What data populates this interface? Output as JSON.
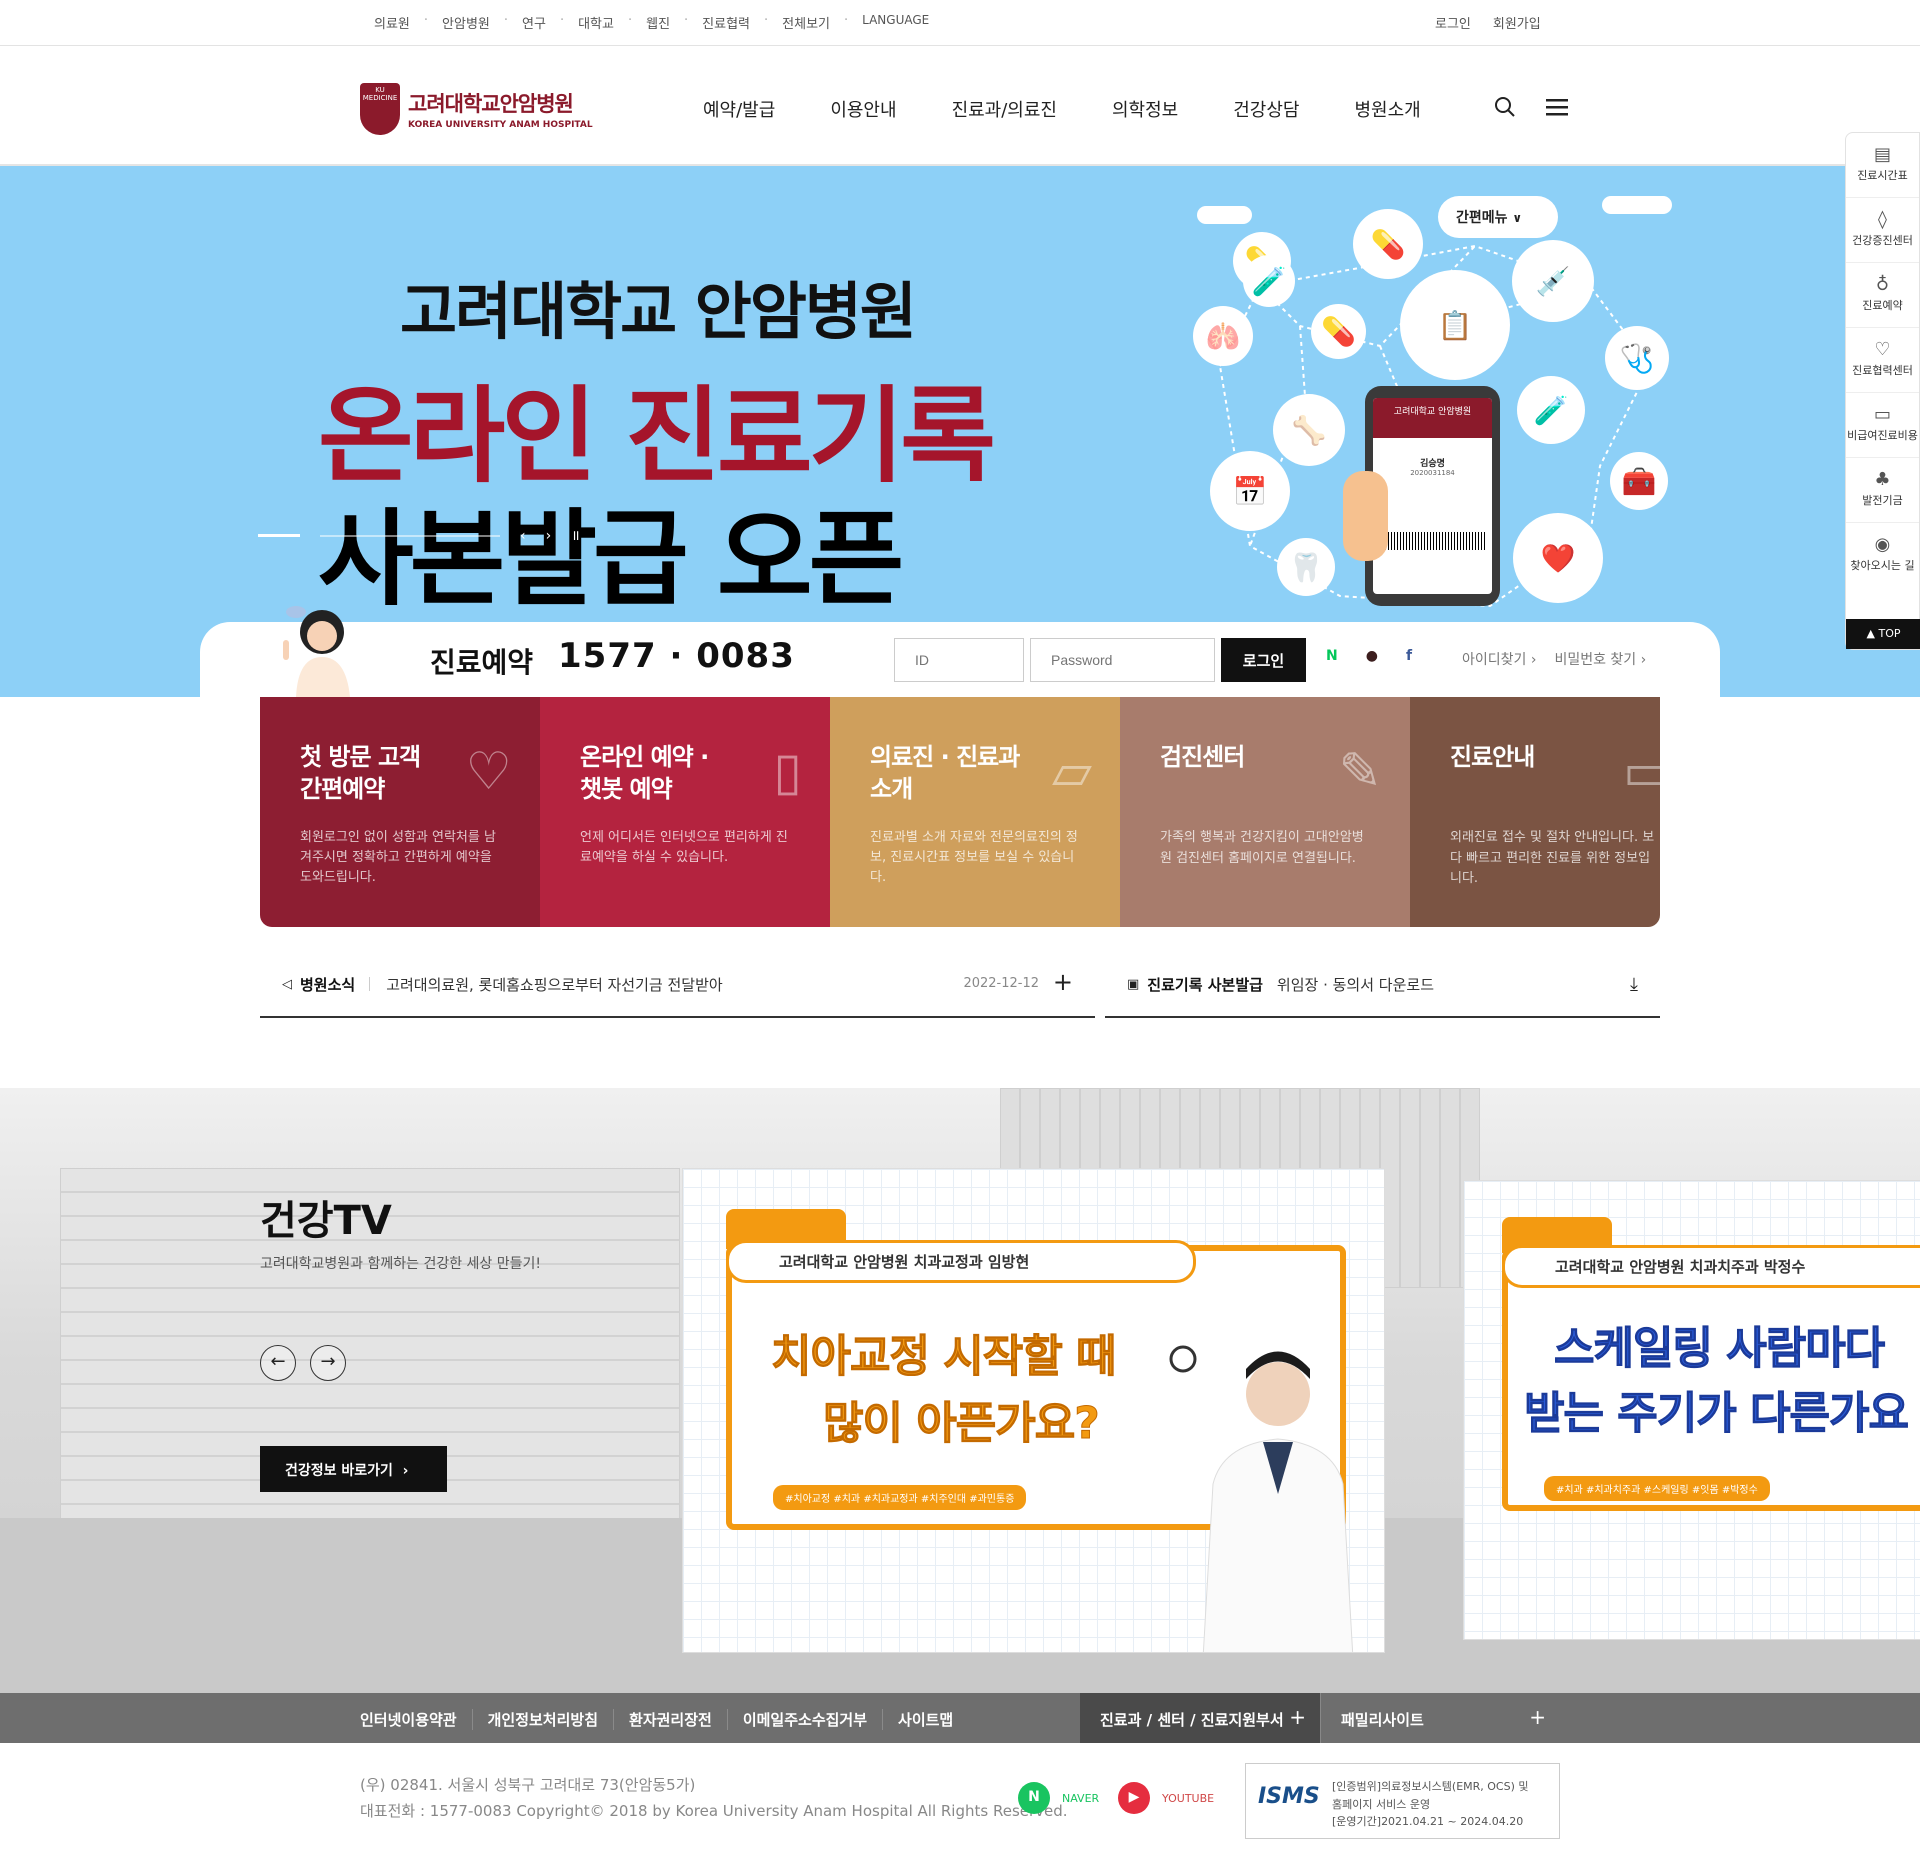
{
  "util": {
    "links": [
      "의료원",
      "안암병원",
      "연구",
      "대학교",
      "웹진",
      "진료협력",
      "전체보기",
      "LANGUAGE"
    ],
    "login": "로그인",
    "join": "회원가입"
  },
  "logo": {
    "name": "고려대학교안암병원",
    "en": "KOREA UNIVERSITY ANAM HOSPITAL",
    "mark": "KU MEDICINE"
  },
  "gnb": [
    "예약/발급",
    "이용안내",
    "진료과/의료진",
    "의학정보",
    "건강상담",
    "병원소개"
  ],
  "hero": {
    "line1": "고려대학교 안암병원",
    "line2": "온라인 진료기록",
    "line3": "사본발급 오픈",
    "easy_menu": "간편메뉴",
    "phone_title": "고려대학교 안암병원",
    "phone_name": "김승명",
    "phone_id": "2020031184",
    "accent": "#a5152b",
    "bg": "#8dd0f7"
  },
  "loginbar": {
    "call_label": "진료예약",
    "call_number": "1577 · 0083",
    "id_placeholder": "ID",
    "pw_placeholder": "Password",
    "login_button": "로그인",
    "find_id": "아이디찾기 ›",
    "find_pw": "비밀번호 찾기 ›"
  },
  "cards": [
    {
      "title": "첫 방문 고객\n간편예약",
      "desc": "회원로그인 없이 성함과 연락처를 남겨주시면 정확하고 간편하게 예약을 도와드립니다.",
      "color": "#8d1e32",
      "icon": "heart-icon"
    },
    {
      "title": "온라인 예약 ·\n챗봇 예약",
      "desc": "언제 어디서든 인터넷으로 편리하게 진료예약을 하실 수 있습니다.",
      "color": "#b4233f",
      "icon": "note-icon"
    },
    {
      "title": "의료진 · 진료과\n소개",
      "desc": "진료과별 소개 자료와 전문의료진의 정보, 진료시간표 정보를 보실 수 있습니다.",
      "color": "#cf9f5c",
      "icon": "folder-icon"
    },
    {
      "title": "검진센터",
      "desc": "가족의 행복과 건강지킴이 고대안암병원 검진센터 홈페이지로 연결됩니다.",
      "color": "#a87c6c",
      "icon": "syringe-icon"
    },
    {
      "title": "진료안내",
      "desc": "외래진료 접수 및 절차 안내입니다. 보다 빠르고 편리한 진료를 위한 정보입니다.",
      "color": "#7b5443",
      "icon": "bag-icon"
    }
  ],
  "news": {
    "label": "병원소식",
    "text": "고려대의료원, 롯데홈쇼핑으로부터 자선기금 전달받아",
    "date": "2022-12-12"
  },
  "copy": {
    "label": "진료기록 사본발급",
    "text": "위임장 · 동의서 다운로드"
  },
  "tv": {
    "title": "건강TV",
    "subtitle": "고려대학교병원과 함께하는 건강한 세상 만들기!",
    "button": "건강정보 바로가기",
    "videos": [
      {
        "head": "고려대학교 안암병원 치과교정과 임방현",
        "line1": "치아교정 시작할 때",
        "line2": "많이 아픈가요?",
        "tags": "#치아교정 #치과 #치과교정과 #치주인대 #과민통증"
      },
      {
        "head": "고려대학교 안암병원 치과치주과 박정수",
        "line1": "스케일링 사람마다",
        "line2": "받는 주기가 다른가요",
        "tags": "#치과 #치과치주과 #스케일링 #잇몸 #박정수"
      }
    ]
  },
  "footer": {
    "links": [
      "인터넷이용약관",
      "개인정보처리방침",
      "환자권리장전",
      "이메일주소수집거부",
      "사이트맵"
    ],
    "select1": "진료과 / 센터 / 진료지원부서",
    "select2": "패밀리사이트",
    "address": "(우) 02841. 서울시 성북구 고려대로 73(안암동5가)",
    "copyright": "대표전화 : 1577-0083 Copyright© 2018 by Korea University Anam Hospital All Rights Reserved.",
    "naver": "NAVER",
    "youtube": "YOUTUBE",
    "isms_logo": "ISMS",
    "isms_text1": "[인증범위]의료정보시스템(EMR, OCS) 및",
    "isms_text2": "홈페이지 서비스 운영",
    "isms_text3": "[운영기간]2021.04.21 ~ 2024.04.20"
  },
  "quick": [
    "진료시간표",
    "건강증진센터",
    "진료예약",
    "진료협력센터",
    "비급여진료비용",
    "발전기금",
    "찾아오시는 길"
  ],
  "quick_top": "▲ TOP"
}
